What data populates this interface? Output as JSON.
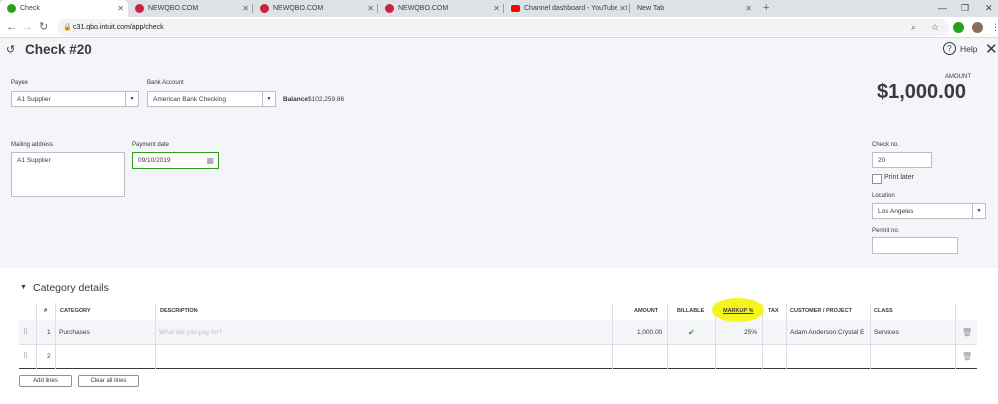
{
  "browser": {
    "tabs": [
      {
        "title": "Check"
      },
      {
        "title": "NEWQBO.COM"
      },
      {
        "title": "NEWQBO.COM"
      },
      {
        "title": "NEWQBO.COM"
      },
      {
        "title": "Channel dashboard - YouTube St"
      },
      {
        "title": "New Tab"
      }
    ],
    "url": "c31.qbo.intuit.com/app/check"
  },
  "header": {
    "title": "Check #20",
    "help_label": "Help"
  },
  "payee": {
    "label": "Payee",
    "value": "A1 Supplier"
  },
  "bank_account": {
    "label": "Bank Account",
    "value": "American Bank Checking",
    "balance_label": "Balance",
    "balance_value": "$102,259.86"
  },
  "amount": {
    "label": "AMOUNT",
    "value": "$1,000.00"
  },
  "mailing_address": {
    "label": "Mailing address",
    "value": "A1 Supplier"
  },
  "payment_date": {
    "label": "Payment date",
    "value": "09/10/2019"
  },
  "check_no": {
    "label": "Check no.",
    "value": "20"
  },
  "print_later": {
    "label": "Print later",
    "checked": false
  },
  "location": {
    "label": "Location",
    "value": "Los Angeles"
  },
  "permit_no": {
    "label": "Permit no.",
    "value": ""
  },
  "category_details": {
    "title": "Category details",
    "columns": [
      "#",
      "CATEGORY",
      "DESCRIPTION",
      "AMOUNT",
      "BILLABLE",
      "MARKUP %",
      "TAX",
      "CUSTOMER / PROJECT",
      "CLASS"
    ],
    "rows": [
      {
        "num": "1",
        "category": "Purchases",
        "description_placeholder": "What did you pay for?",
        "amount": "1,000.00",
        "billable": true,
        "markup": "25%",
        "tax": "",
        "customer": "Adam Anderson:Crystal E",
        "class": "Services"
      },
      {
        "num": "2",
        "category": "",
        "description_placeholder": "",
        "amount": "",
        "billable": false,
        "markup": "",
        "tax": "",
        "customer": "",
        "class": ""
      }
    ],
    "add_lines_label": "Add lines",
    "clear_lines_label": "Clear all lines"
  },
  "colors": {
    "highlight": "#f5f51e",
    "page_bg": "#f4f5f8",
    "date_border": "#2ca01c",
    "tab_youtube": "#ff0000",
    "tab_qbo": "#c9243f",
    "tab_check": "#2ca01c"
  }
}
